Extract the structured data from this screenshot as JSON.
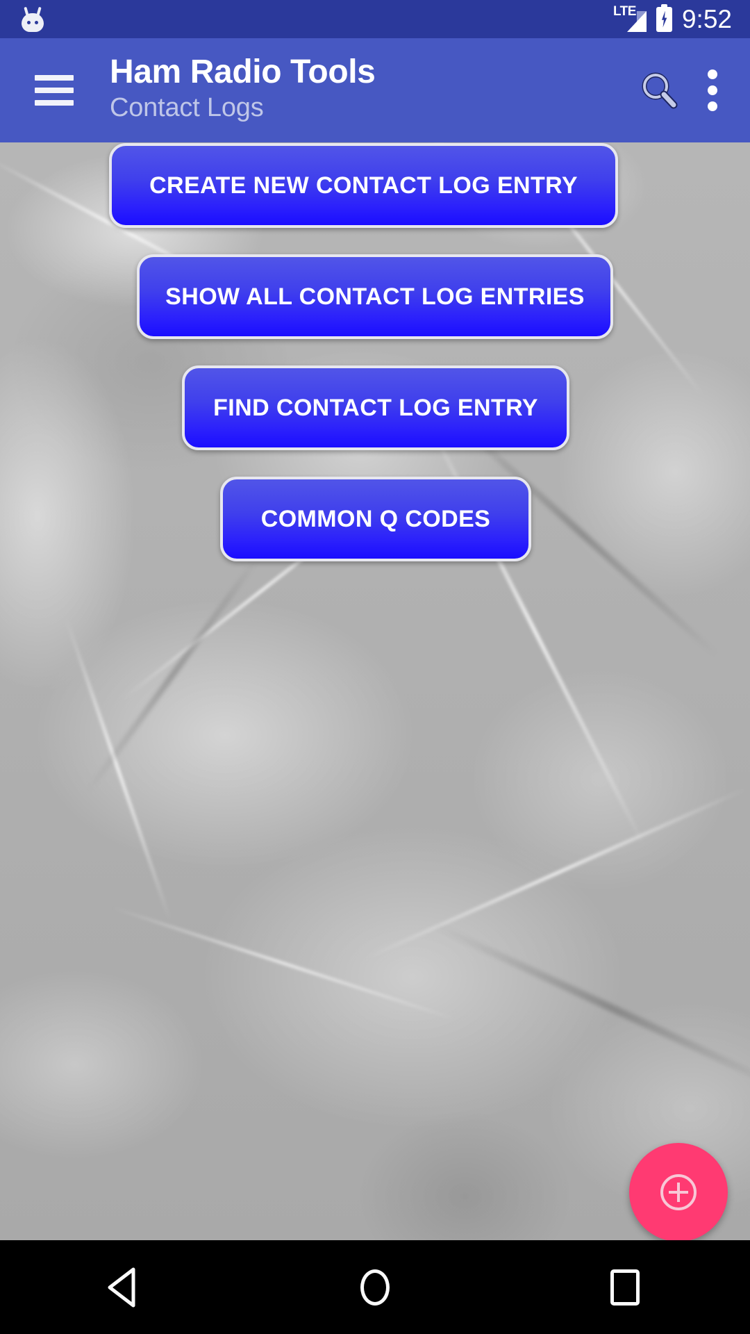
{
  "status_bar": {
    "notification_icon": "android-head-icon",
    "network_type": "LTE",
    "signal_icon": "signal-bars-icon",
    "battery_icon": "battery-charging-icon",
    "time": "9:52",
    "background_color": "#2B399B"
  },
  "app_bar": {
    "menu_icon": "hamburger-menu-icon",
    "title": "Ham Radio Tools",
    "subtitle": "Contact Logs",
    "search_icon": "search-icon",
    "overflow_icon": "more-vertical-icon",
    "background_color": "#4758C2",
    "title_color": "#FFFFFF",
    "subtitle_color": "#BFC6E8"
  },
  "main": {
    "background": "crumpled-gray-paper-texture",
    "buttons": [
      {
        "id": "create-new-contact-log-entry",
        "label": "CREATE NEW CONTACT LOG ENTRY"
      },
      {
        "id": "show-all-contact-log-entries",
        "label": "SHOW ALL CONTACT LOG ENTRIES"
      },
      {
        "id": "find-contact-log-entry",
        "label": "FIND CONTACT LOG ENTRY"
      },
      {
        "id": "common-q-codes",
        "label": "COMMON Q CODES"
      }
    ],
    "button_gradient_top": "#5155E8",
    "button_gradient_bottom": "#1A0DFF",
    "button_border_color": "#E7E7EF",
    "button_text_color": "#FFFFFF"
  },
  "fab": {
    "icon": "add-circle-icon",
    "color": "#FF3A72",
    "glyph_color": "#F8C7D6"
  },
  "nav_bar": {
    "background_color": "#000000",
    "items": [
      {
        "id": "back",
        "icon": "back-triangle-icon"
      },
      {
        "id": "home",
        "icon": "home-circle-icon"
      },
      {
        "id": "recent",
        "icon": "recents-square-icon"
      }
    ]
  }
}
